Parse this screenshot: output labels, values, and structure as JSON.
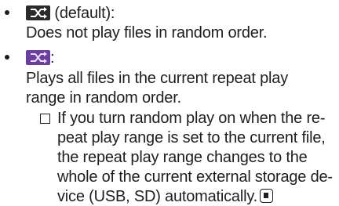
{
  "items": [
    {
      "icon": "random-off-icon",
      "icon_color": "#2a2a2a",
      "suffix": " (default):",
      "description": "Does not play files in random order."
    },
    {
      "icon": "random-on-icon",
      "icon_color": "#6b3fa0",
      "suffix": ":",
      "description_lines": [
        "Plays all files in the current repeat play",
        "range in random order."
      ],
      "note_lines": [
        "If you turn random play on when the re-",
        "peat play range is set to the current file,",
        "the repeat play range changes to the",
        "whole of the current external storage de-",
        "vice (USB, SD) automatically."
      ]
    }
  ]
}
